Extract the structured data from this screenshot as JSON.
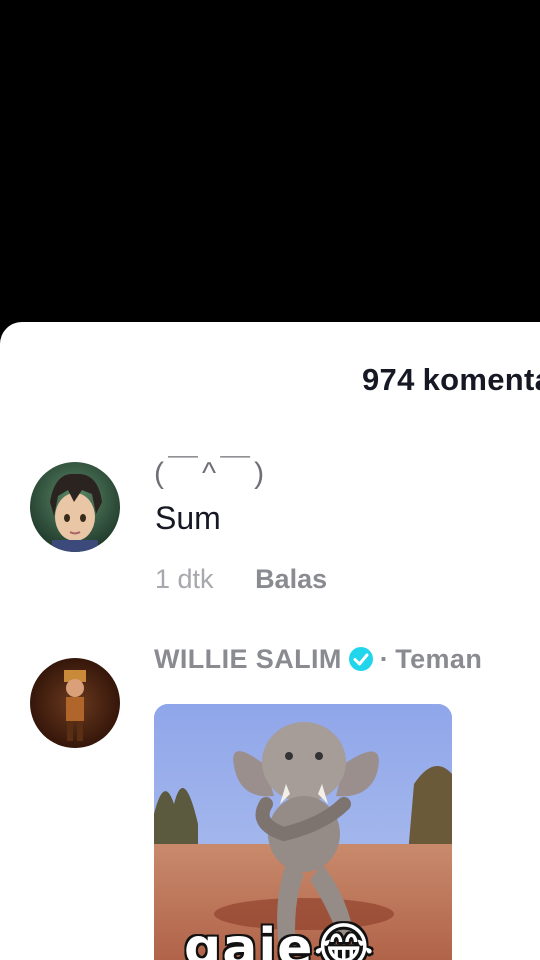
{
  "comments_sheet": {
    "count": "974",
    "count_label": "komentar"
  },
  "comments": [
    {
      "username": "(￣^￣)",
      "text": "Sum",
      "time": "1 dtk",
      "reply_label": "Balas"
    },
    {
      "username": "WILLIE SALIM",
      "verified": true,
      "separator": "·",
      "relation": "Teman",
      "gif_caption": "gaje😂"
    }
  ],
  "colors": {
    "verified_badge": "#20d5ec",
    "username_gray": "#8a8b91",
    "text_dark": "#161823"
  }
}
